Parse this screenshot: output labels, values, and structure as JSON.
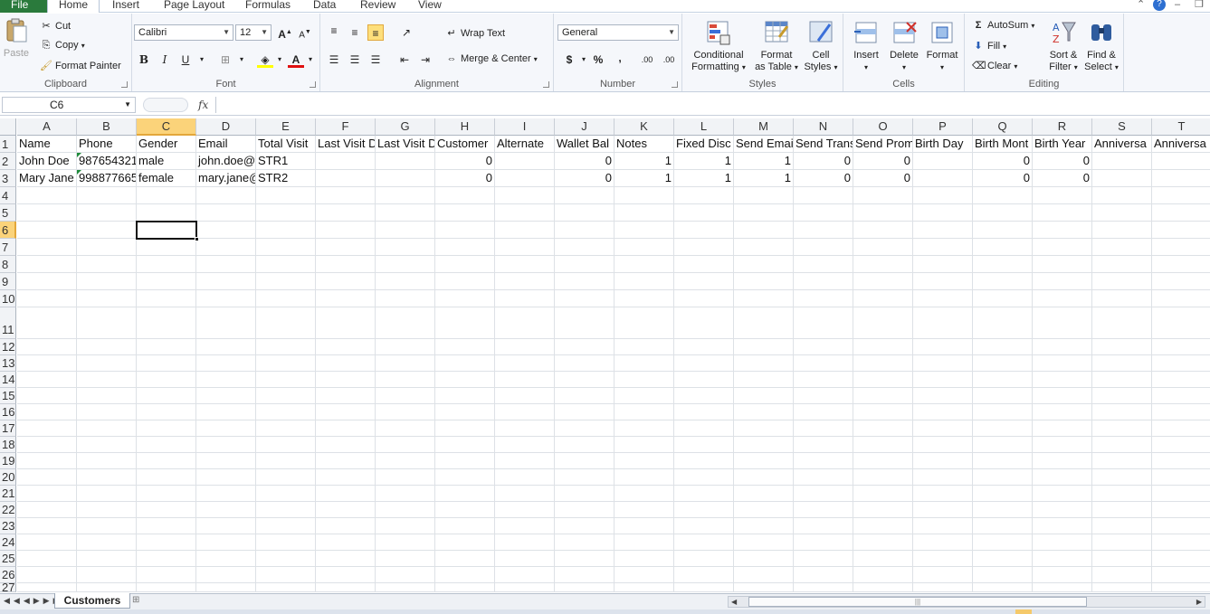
{
  "tabs": {
    "file": "File",
    "items": [
      "Home",
      "Insert",
      "Page Layout",
      "Formulas",
      "Data",
      "Review",
      "View"
    ],
    "active": "Home"
  },
  "clipboard": {
    "paste": "Paste",
    "cut": "Cut",
    "copy": "Copy",
    "format_painter": "Format Painter",
    "label": "Clipboard"
  },
  "font": {
    "family": "Calibri",
    "size": "12",
    "bold": "B",
    "italic": "I",
    "underline": "U",
    "label": "Font"
  },
  "alignment": {
    "wrap_text": "Wrap Text",
    "merge_center": "Merge & Center",
    "label": "Alignment"
  },
  "number": {
    "format": "General",
    "currency": "$",
    "percent": "%",
    "comma": ",",
    "inc_decimal": ".00",
    "dec_decimal": ".00",
    "label": "Number"
  },
  "styles": {
    "conditional_formatting": [
      "Conditional",
      "Formatting"
    ],
    "format_as_table": [
      "Format",
      "as Table"
    ],
    "cell_styles": [
      "Cell",
      "Styles"
    ],
    "label": "Styles"
  },
  "cells": {
    "insert": "Insert",
    "delete": "Delete",
    "format": "Format",
    "label": "Cells"
  },
  "editing": {
    "autosum": "AutoSum",
    "fill": "Fill",
    "clear": "Clear",
    "sort_filter": [
      "Sort &",
      "Filter"
    ],
    "find_select": [
      "Find &",
      "Select"
    ],
    "label": "Editing"
  },
  "formula_bar": {
    "name_box": "C6",
    "fx": "fx",
    "value": ""
  },
  "grid": {
    "columns": [
      "A",
      "B",
      "C",
      "D",
      "E",
      "F",
      "G",
      "H",
      "I",
      "J",
      "K",
      "L",
      "M",
      "N",
      "O",
      "P",
      "Q",
      "R",
      "S",
      "T"
    ],
    "rows": [
      "1",
      "2",
      "3",
      "4",
      "5",
      "6",
      "7",
      "8",
      "9",
      "10",
      "11",
      "12",
      "13",
      "14",
      "15",
      "16",
      "17",
      "18",
      "19",
      "20",
      "21",
      "22",
      "23",
      "24",
      "25",
      "26",
      "27"
    ],
    "active_column": "C",
    "active_row": "6",
    "header_row": [
      "Name",
      "Phone",
      "Gender",
      "Email",
      "Total Visit",
      "Last Visit D",
      "Last Visit D",
      "Customer",
      "Alternate",
      "Wallet Bal",
      "Notes",
      "Fixed Disc",
      "Send Emai",
      "Send Trans",
      "Send Prom",
      "Birth Day",
      "Birth Mont",
      "Birth Year",
      "Anniversa",
      "Anniversa"
    ],
    "data_rows": [
      [
        "John Doe",
        "987654321",
        "male",
        "john.doe@gmail.com",
        "STR1",
        "",
        "",
        "0",
        "",
        "0",
        "1",
        "1",
        "1",
        "0",
        "0",
        "",
        "0",
        "0",
        "",
        ""
      ],
      [
        "Mary Jane",
        "998877665",
        "female",
        "mary.jane@gmail.com",
        "STR2",
        "",
        "",
        "0",
        "",
        "0",
        "1",
        "1",
        "1",
        "0",
        "0",
        "",
        "0",
        "0",
        "",
        ""
      ]
    ]
  },
  "sheets": {
    "active": "Customers"
  }
}
